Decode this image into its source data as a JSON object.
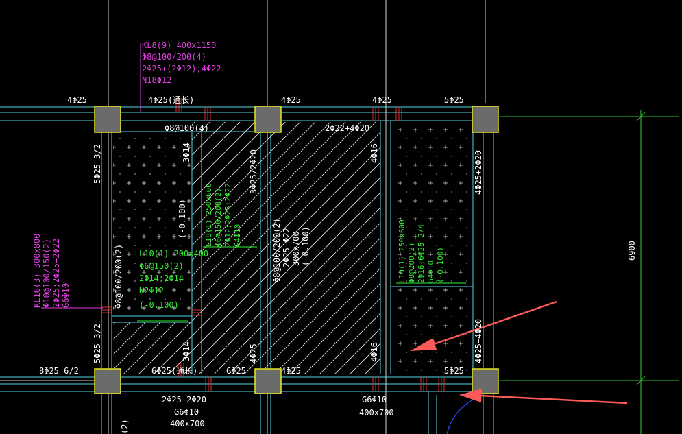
{
  "drawing": {
    "background": "#000000",
    "colors": {
      "beam_line": "#4fd6e6",
      "column_fill": "#6b6b6b",
      "column_border": "#e6e620",
      "magenta_text": "#e040e0",
      "green_text": "#33ee33",
      "dimension": "#33cc33",
      "arrow": "#ff5a5a",
      "rebar_mark": "#e03030"
    },
    "beam_labels": {
      "kl8": [
        "KL8(9) 400x1150",
        "Φ8@100/200(4)",
        "2Φ25+(2Φ12);4Φ22",
        "N18Φ12"
      ],
      "kl16": [
        "KL16(3) 300x800",
        "Φ10@100/150(2)",
        "2Φ25;2Φ25+2Φ22",
        "G6Φ10"
      ],
      "l10": [
        "L10(1) 200x400",
        "Φ6@150(2)",
        "2Φ14;2Φ14",
        "N2Φ12",
        "(-0.100)"
      ],
      "l18": [
        "L18(1) 250x600",
        "Φ6@150/200(2)",
        "2Φ12;2Φ25+2Φ22",
        "G4Φ10"
      ],
      "l19": [
        "L19(1) 250x600",
        "Φ8@200(2)",
        "2Φ16;6Φ25 2/4",
        "G4Φ10",
        "(-0.100)"
      ],
      "mid_beam": [
        "Φ8@100/200(2)",
        "2Φ25+Φ22",
        "300x700",
        "(-0.100)"
      ],
      "bottom_right": [
        "G6Φ10",
        "400x700"
      ],
      "bottom_left": [
        "2Φ25+2Φ20",
        "G6Φ10",
        "400x700"
      ]
    },
    "top_reinforcement": {
      "t1": "4Φ25",
      "t2": "4Φ25(通长)",
      "t3": "4Φ25",
      "t4": "4Φ25",
      "t5": "5Φ25",
      "stirrup": "Φ8@100(4)",
      "mid": "2Φ22+4Φ20"
    },
    "bottom_reinforcement": {
      "b1": "8Φ25 6/2",
      "b2": "6Φ25(通长)",
      "b3": "6Φ25",
      "b4": "4Φ25",
      "b5": "5Φ25"
    },
    "vertical_labels": {
      "left_top": "5Φ25 3/2",
      "left_bottom": "5Φ25 3/2",
      "left_stirrup": "Φ8@100/200(2)",
      "col1_top": "3Φ14",
      "col1_bottom": "3Φ14",
      "col1_elev": "(-0.100)",
      "col2_top": "3Φ25/2Φ20",
      "col2_bottom": "4Φ25",
      "col3_top": "4Φ16",
      "col3_bottom": "4Φ16",
      "right_top": "4Φ25+2Φ20",
      "right_bottom": "4Φ25+4Φ20",
      "edge_bottom": "(2)"
    },
    "dimension_text": "6900"
  }
}
